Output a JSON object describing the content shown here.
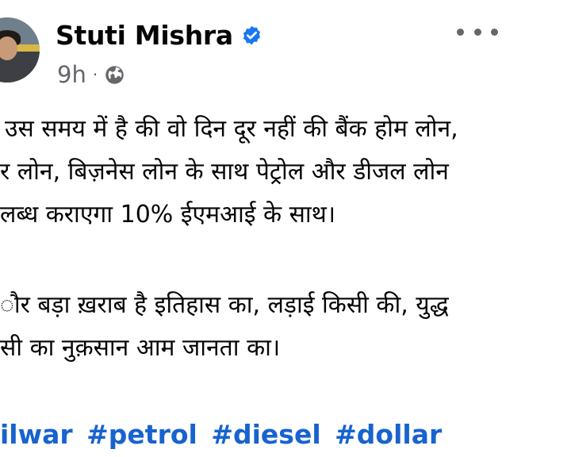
{
  "post": {
    "author": "Stuti Mishra",
    "time": "9h",
    "separator": "·",
    "icons": {
      "verified": "verified-badge-icon",
      "privacy": "globe-icon",
      "more": "more-options-icon"
    },
    "colors": {
      "link": "#1763cf",
      "meta": "#65676b",
      "verified": "#1877f2"
    },
    "lines": [
      "उस समय में है की वो दिन दूर नहीं की बैंक होम लोन,",
      "र लोन, बिज़नेस लोन के साथ पेट्रोल और डीजल लोन",
      "लब्ध कराएगा 10% ईएमआई के साथ।",
      "ौर बड़ा ख़राब है इतिहास का, लड़ाई किसी की, युद्ध",
      "सी का  नुक़सान आम जानता का।"
    ],
    "hashtags": [
      "ilwar",
      "#petrol",
      "#diesel",
      "#dollar"
    ]
  }
}
